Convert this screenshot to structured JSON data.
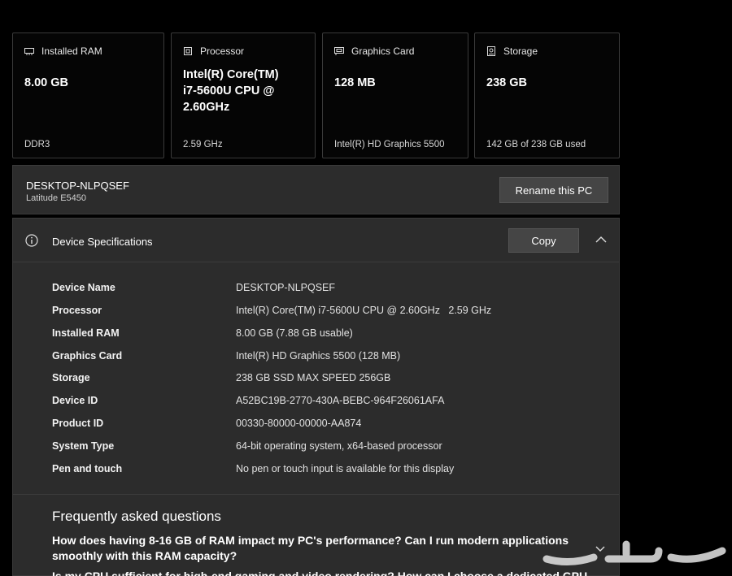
{
  "cards": [
    {
      "title": "Installed RAM",
      "icon": "ram-icon",
      "value": "8.00 GB",
      "sub": "DDR3"
    },
    {
      "title": "Processor",
      "icon": "processor-icon",
      "value_lines": [
        "Intel(R) Core(TM)",
        "i7-5600U CPU @",
        "2.60GHz"
      ],
      "sub": "2.59 GHz"
    },
    {
      "title": "Graphics Card",
      "icon": "graphics-card-icon",
      "value": "128 MB",
      "sub": "Intel(R) HD Graphics 5500"
    },
    {
      "title": "Storage",
      "icon": "storage-icon",
      "value": "238 GB",
      "sub": "142 GB of 238 GB used"
    }
  ],
  "pc": {
    "name": "DESKTOP-NLPQSEF",
    "model": "Latitude E5450",
    "rename_label": "Rename this PC"
  },
  "specs": {
    "title": "Device Specifications",
    "copy_label": "Copy",
    "rows": [
      {
        "label": "Device Name",
        "value": "DESKTOP-NLPQSEF"
      },
      {
        "label": "Processor",
        "value": "Intel(R) Core(TM) i7-5600U CPU @ 2.60GHz   2.59 GHz"
      },
      {
        "label": "Installed RAM",
        "value": "8.00 GB (7.88 GB usable)"
      },
      {
        "label": "Graphics Card",
        "value": "Intel(R) HD Graphics 5500 (128 MB)"
      },
      {
        "label": "Storage",
        "value": "238 GB SSD MAX SPEED 256GB"
      },
      {
        "label": "Device ID",
        "value": "A52BC19B-2770-430A-BEBC-964F26061AFA"
      },
      {
        "label": "Product ID",
        "value": "00330-80000-00000-AA874"
      },
      {
        "label": "System Type",
        "value": "64-bit operating system, x64-based processor"
      },
      {
        "label": "Pen and touch",
        "value": "No pen or touch input is available for this display"
      }
    ]
  },
  "faq": {
    "title": "Frequently asked questions",
    "q1": "How does having 8-16 GB of RAM impact my PC's performance? Can I run modern applications smoothly with this RAM capacity?",
    "q2": "Is my CPU sufficient for high-end gaming and video rendering? How can I choose a dedicated GPU"
  },
  "colors": {
    "background": "#000000",
    "panel": "#2c2c2c",
    "card": "#050505",
    "button": "#454545",
    "border": "#3a3a3a"
  }
}
